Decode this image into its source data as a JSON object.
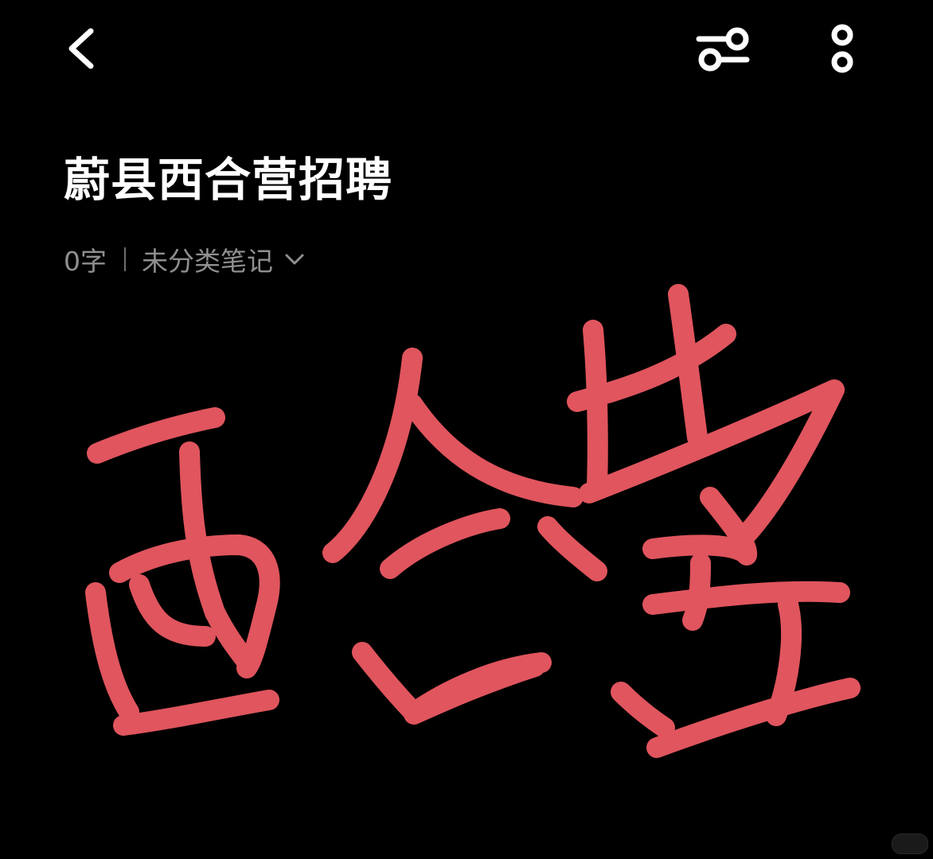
{
  "header": {
    "back_icon": "chevron-left-icon",
    "filter_icon": "sliders-icon",
    "more_icon": "vertical-dots-icon"
  },
  "note": {
    "title": "蔚县西合营招聘",
    "word_count": "0字",
    "category": "未分类笔记"
  },
  "handwriting": {
    "content": "西合营",
    "stroke_color": "#E0555E"
  },
  "colors": {
    "background": "#000000",
    "text_primary": "#FFFFFF",
    "text_secondary": "#8F8F8F"
  }
}
